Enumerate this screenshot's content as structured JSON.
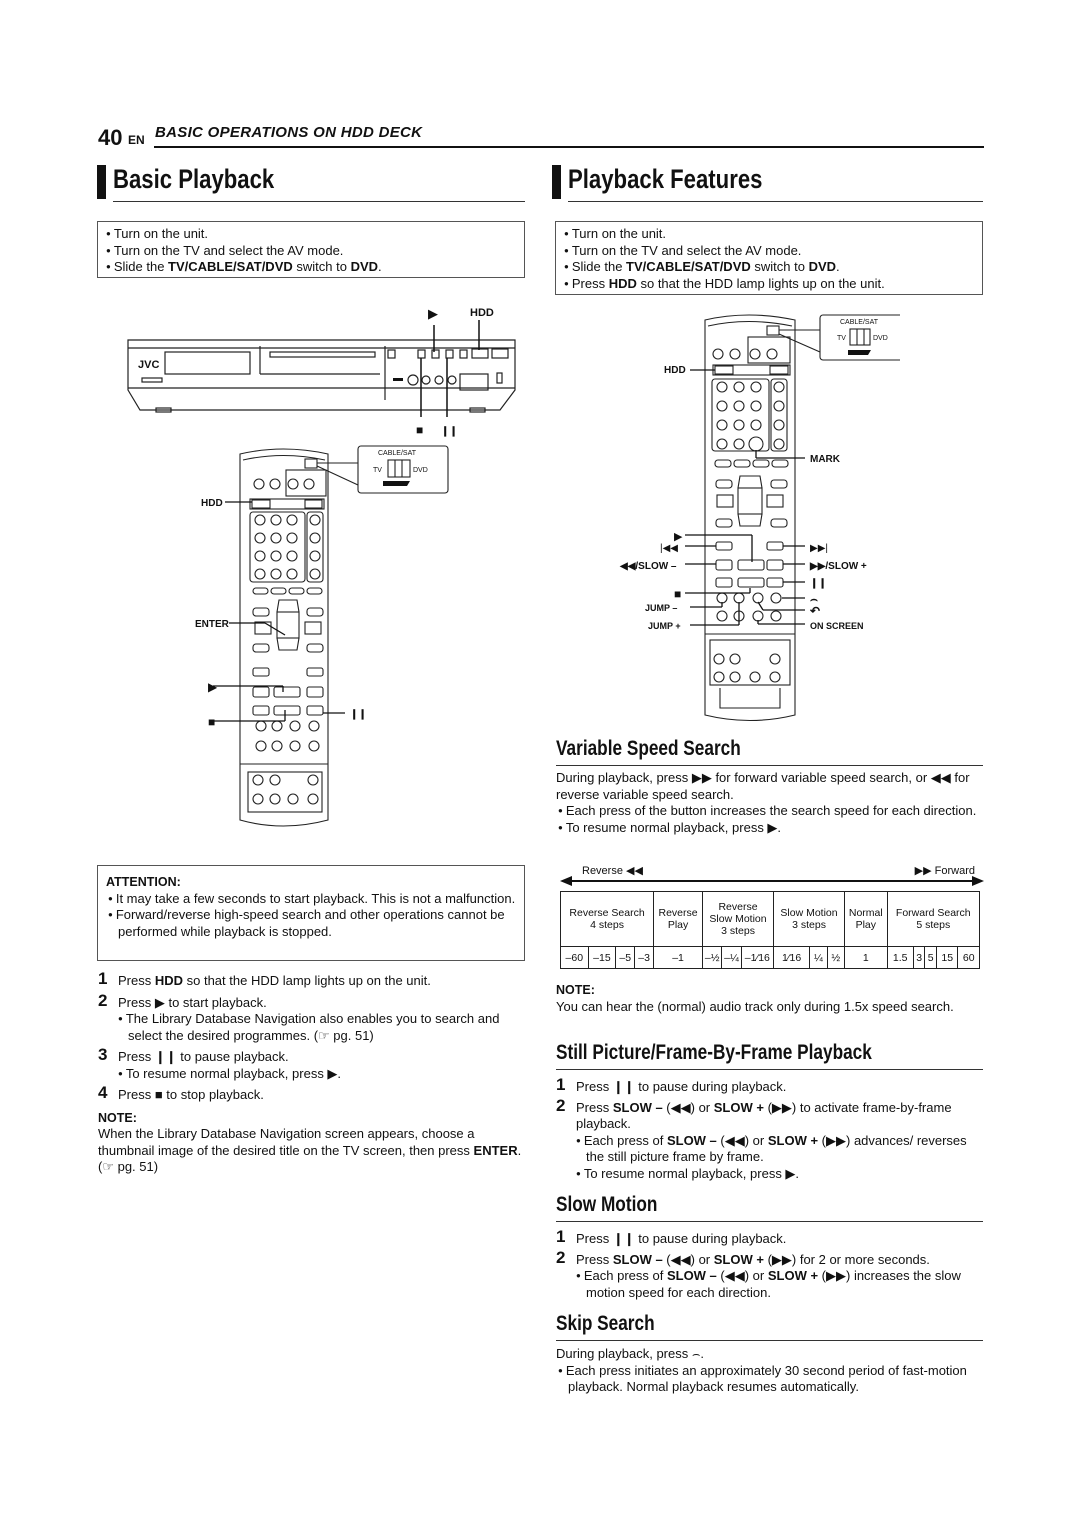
{
  "header": {
    "page_number": "40",
    "lang": "EN",
    "section": "BASIC OPERATIONS ON HDD DECK"
  },
  "basic_playback": {
    "title": "Basic Playback",
    "prep": [
      {
        "pre": "Turn on the unit.",
        "b1": "",
        "mid": "",
        "b2": "",
        "post": ""
      },
      {
        "pre": "Turn on the TV and select the AV mode.",
        "b1": "",
        "mid": "",
        "b2": "",
        "post": ""
      },
      {
        "pre": "Slide the ",
        "b1": "TV/CABLE/SAT/DVD",
        "mid": " switch to ",
        "b2": "DVD",
        "post": "."
      }
    ],
    "deck_labels": {
      "play": "▶",
      "hdd": "HDD",
      "stop": "■",
      "pause": "❙❙",
      "brand": "JVC"
    },
    "remote_labels": {
      "hdd": "HDD",
      "enter": "ENTER",
      "play": "▶",
      "stop": "■",
      "pause": "❙❙"
    },
    "switch_labels": {
      "top": "CABLE/SAT",
      "left": "TV",
      "right": "DVD"
    },
    "attention": {
      "heading": "ATTENTION:",
      "items": [
        "It may take a few seconds to start playback. This is not a malfunction.",
        "Forward/reverse high-speed search and other operations cannot be performed while playback is stopped."
      ]
    },
    "steps": [
      {
        "num": "1",
        "pre": "Press ",
        "bold": "HDD",
        "post": " so that the HDD lamp lights up on the unit."
      },
      {
        "num": "2",
        "pre": "Press ▶ to start playback.",
        "bold": "",
        "post": ""
      },
      {
        "num": "3",
        "pre": "Press ❙❙ to pause playback.",
        "bold": "",
        "post": ""
      },
      {
        "num": "4",
        "pre": "Press ■ to stop playback.",
        "bold": "",
        "post": ""
      }
    ],
    "step2_sub": "The Library Database Navigation also enables you to search and select the desired programmes. (☞ pg. 51)",
    "step3_sub": "To resume normal playback, press ▶.",
    "note": {
      "heading": "NOTE:",
      "text": "When the Library Database Navigation screen appears, choose a thumbnail image of the desired title on the TV screen, then press ",
      "bold": "ENTER",
      "post": ". (☞ pg. 51)"
    }
  },
  "playback_features": {
    "title": "Playback Features",
    "prep": [
      {
        "pre": "Turn on the unit.",
        "b1": "",
        "mid": "",
        "b2": "",
        "post": ""
      },
      {
        "pre": "Turn on the TV and select the AV mode.",
        "b1": "",
        "mid": "",
        "b2": "",
        "post": ""
      },
      {
        "pre": "Slide the ",
        "b1": "TV/CABLE/SAT/DVD",
        "mid": " switch to ",
        "b2": "DVD",
        "post": "."
      },
      {
        "pre": "Press ",
        "b1": "HDD",
        "mid": " so that the HDD lamp lights up on the unit.",
        "b2": "",
        "post": ""
      }
    ],
    "remote_labels": {
      "hdd": "HDD",
      "mark": "MARK",
      "play": "▶",
      "prev": "|◀◀",
      "next": "▶▶|",
      "slow_minus": "◀◀/SLOW –",
      "slow_plus": "▶▶/SLOW +",
      "stop": "■",
      "pause": "❙❙",
      "jump_minus": "JUMP –",
      "jump_plus": "JUMP +",
      "skip_fwd": "⌢",
      "skip_back": "↶",
      "on_screen": "ON SCREEN"
    },
    "switch_labels": {
      "top": "CABLE/SAT",
      "left": "TV",
      "right": "DVD"
    },
    "variable_speed": {
      "title": "Variable Speed Search",
      "intro": "During playback, press ▶▶ for forward variable speed search, or ◀◀ for reverse variable speed search.",
      "bullets": [
        "Each press of the button increases the search speed for each direction.",
        "To resume normal playback, press ▶."
      ],
      "diagram": {
        "reverse_label": "Reverse ◀◀",
        "forward_label": "▶▶ Forward",
        "groups": [
          {
            "label": "Reverse Search\n4 steps",
            "values": [
              "–60",
              "–15",
              "–5",
              "–3"
            ]
          },
          {
            "label": "Reverse\nPlay",
            "values": [
              "–1"
            ]
          },
          {
            "label": "Reverse\nSlow Motion\n3 steps",
            "values": [
              "–½",
              "–¼",
              "–1⁄16"
            ]
          },
          {
            "label": "Slow Motion\n3 steps",
            "values": [
              "1⁄16",
              "¼",
              "½"
            ]
          },
          {
            "label": "Normal\nPlay",
            "values": [
              "1"
            ]
          },
          {
            "label": "Forward Search\n5 steps",
            "values": [
              "1.5",
              "3",
              "5",
              "15",
              "60"
            ]
          }
        ]
      },
      "note": {
        "heading": "NOTE:",
        "text": "You can hear the (normal) audio track only during 1.5x speed search."
      }
    },
    "still_picture": {
      "title": "Still Picture/Frame-By-Frame Playback",
      "step1": "Press ❙❙ to pause during playback.",
      "step2_a": "Press ",
      "step2_b1": "SLOW –",
      "step2_c": " (◀◀) or ",
      "step2_b2": "SLOW +",
      "step2_d": " (▶▶) to activate frame-by-frame playback.",
      "sub1_a": "Each press of ",
      "sub1_b1": "SLOW –",
      "sub1_c": " (◀◀) or ",
      "sub1_b2": "SLOW +",
      "sub1_d": " (▶▶) advances/ reverses the still picture frame by frame.",
      "sub2": "To resume normal playback, press ▶."
    },
    "slow_motion": {
      "title": "Slow Motion",
      "step1": "Press ❙❙ to pause during playback.",
      "step2_a": "Press ",
      "step2_b1": "SLOW –",
      "step2_c": " (◀◀) or ",
      "step2_b2": "SLOW +",
      "step2_d": " (▶▶) for 2 or more seconds.",
      "sub1_a": "Each press of ",
      "sub1_b1": "SLOW –",
      "sub1_c": " (◀◀) or ",
      "sub1_b2": "SLOW +",
      "sub1_d": " (▶▶) increases the slow motion speed for each direction."
    },
    "skip_search": {
      "title": "Skip Search",
      "intro": "During playback, press ⌢.",
      "bullet": "Each press initiates an approximately 30 second period of fast-motion playback. Normal playback resumes automatically."
    }
  }
}
